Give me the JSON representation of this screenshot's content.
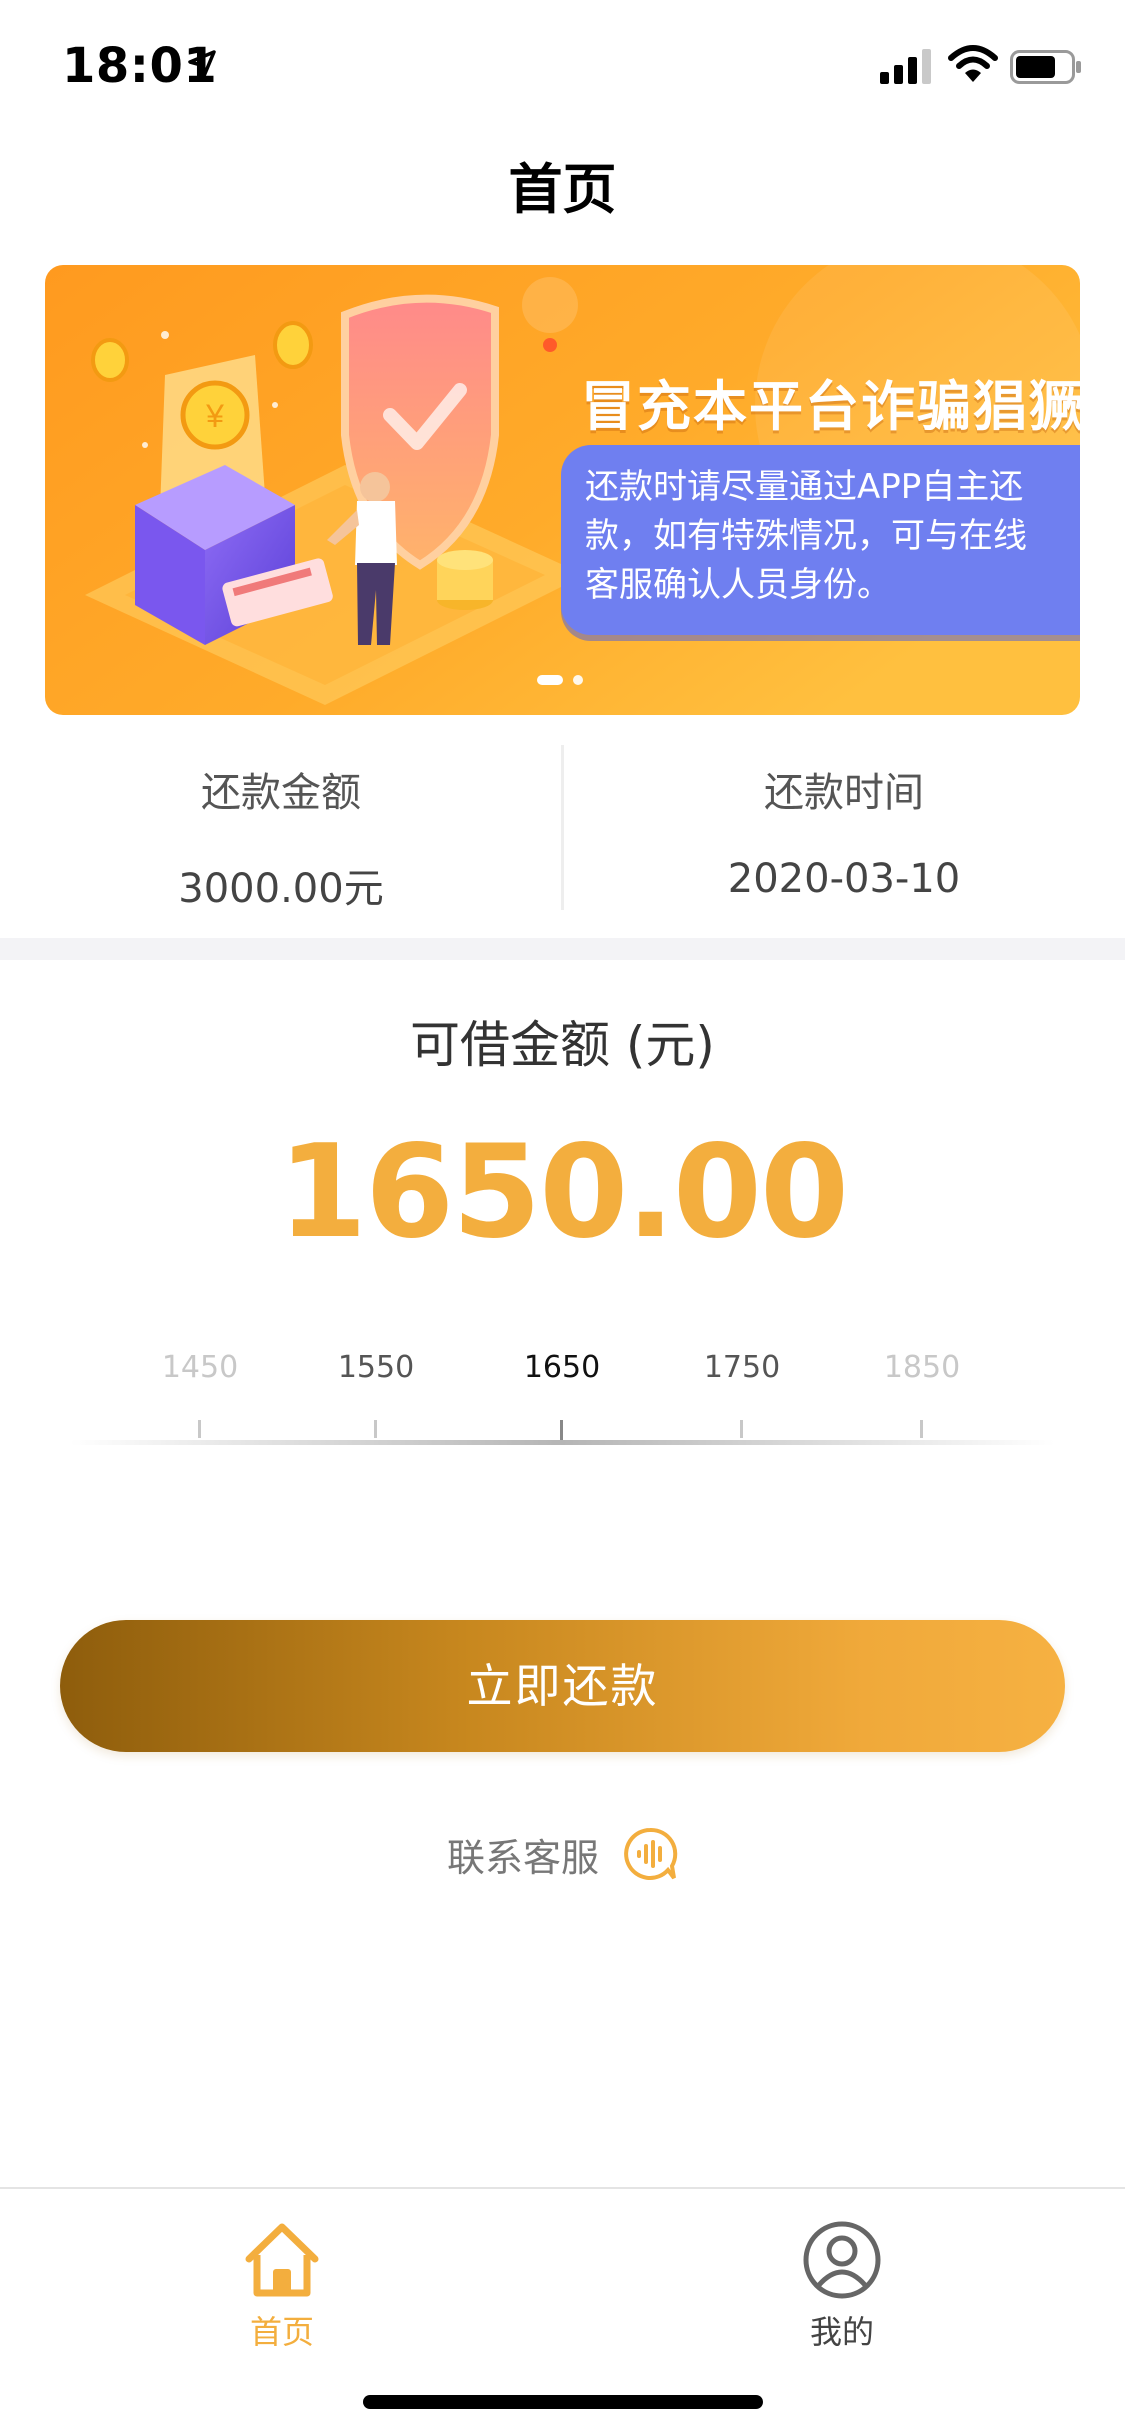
{
  "status_bar": {
    "time": "18:01"
  },
  "nav": {
    "title": "首页"
  },
  "banner": {
    "headline": "冒充本平台诈骗猖獗",
    "notice": "还款时请尽量通过APP自主还款，如有特殊情况，可与在线客服确认人员身份。",
    "notice_lines": "还款时请尽量通过APP自主还\n款，如有特殊情况，可与在线\n客服确认人员身份。",
    "slide_count": 2,
    "active_slide": 1
  },
  "repayment": {
    "amount_label": "还款金额",
    "amount_value": "3000.00元",
    "date_label": "还款时间",
    "date_value": "2020-03-10"
  },
  "borrow": {
    "label": "可借金额 (元)",
    "amount": "1650.00",
    "slider": {
      "ticks": [
        "1450",
        "1550",
        "1650",
        "1750",
        "1850"
      ],
      "selected": "1650"
    }
  },
  "actions": {
    "repay_button": "立即还款",
    "contact_label": "联系客服"
  },
  "tabbar": {
    "items": [
      {
        "label": "首页",
        "icon": "home-icon",
        "active": true
      },
      {
        "label": "我的",
        "icon": "profile-icon",
        "active": false
      }
    ]
  },
  "colors": {
    "accent": "#f3ae3e",
    "button_gradient_start": "#8e5d0c",
    "button_gradient_end": "#f6b142",
    "banner_orange": "#ffa21f",
    "notice_card": "#6f7ff0"
  }
}
